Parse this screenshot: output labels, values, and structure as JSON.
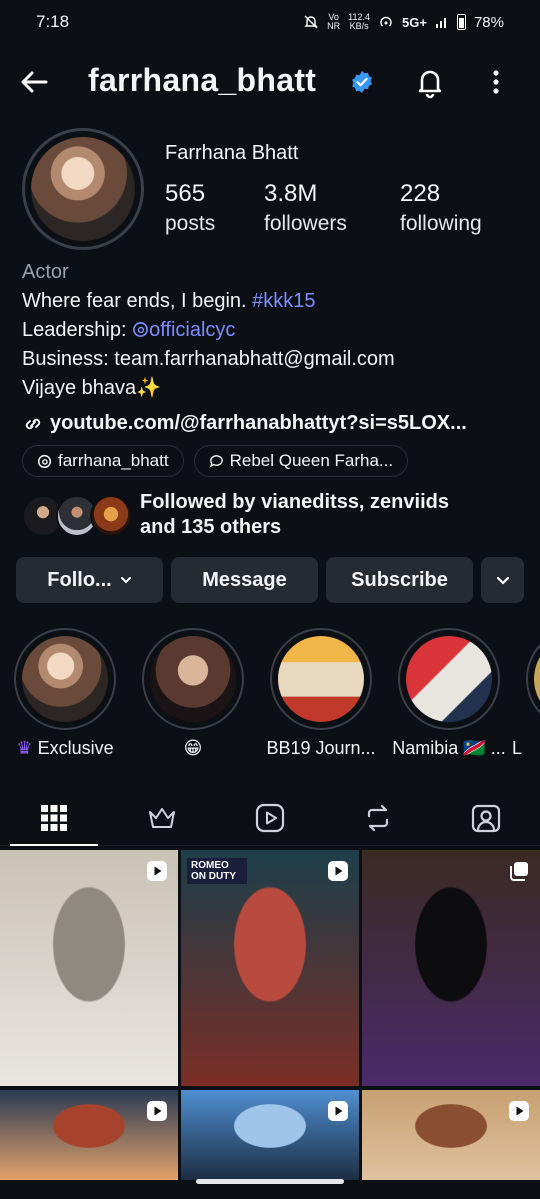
{
  "status": {
    "time": "7:18",
    "data_speed": "112.4",
    "data_unit": "KB/s",
    "volte": "Vo",
    "volte_sub": "NR",
    "network": "5G+",
    "battery": "78%",
    "battery_level": 0.78
  },
  "header": {
    "username": "farrhana_bhatt",
    "verified": true
  },
  "profile": {
    "full_name": "Farrhana Bhatt",
    "stats": [
      {
        "value": "565",
        "label": "posts"
      },
      {
        "value": "3.8M",
        "label": "followers"
      },
      {
        "value": "228",
        "label": "following"
      }
    ]
  },
  "bio": {
    "category": "Actor",
    "line1_text": "Where fear ends, I begin. ",
    "line1_tag": "#kkk15",
    "line2_text": "Leadership: ",
    "line2_handle": "officialcyc",
    "line3": "Business: team.farrhanabhatt@gmail.com",
    "line4": "Vijaye bhava✨",
    "link": "youtube.com/@farrhanabhattyt?si=s5LOX..."
  },
  "chips": [
    {
      "label": "farrhana_bhatt",
      "icon": "threads-icon"
    },
    {
      "label": "Rebel Queen Farha...",
      "icon": "chat-icon"
    }
  ],
  "followed_by": {
    "line1": "Followed by vianeditss, zenviids",
    "line2": "and 135 others"
  },
  "actions": {
    "follow": "Follo...",
    "message": "Message",
    "subscribe": "Subscribe"
  },
  "highlights": [
    {
      "label": "Exclusive",
      "prefix_icon": "crown-icon"
    },
    {
      "label": "😁"
    },
    {
      "label": "BB19 Journ..."
    },
    {
      "label": "Namibia 🇳🇦 ..."
    },
    {
      "label": "L"
    }
  ],
  "tabs": [
    "grid-icon",
    "crown-icon",
    "reels-icon",
    "repost-icon",
    "tagged-icon"
  ],
  "grid_posts": [
    {
      "type": "reel",
      "colors": [
        "#c9c3b6",
        "#8f8a80",
        "#e9e6e0"
      ]
    },
    {
      "type": "reel",
      "colors": [
        "#1c3e4a",
        "#b94b3e",
        "#7a2e26"
      ],
      "overlay": "ROMEO ON DUTY"
    },
    {
      "type": "carousel",
      "colors": [
        "#3a2a22",
        "#0d0d10",
        "#4b2a6a"
      ]
    },
    {
      "type": "reel",
      "colors": [
        "#2b3a55",
        "#a7432c",
        "#e2a26a"
      ]
    },
    {
      "type": "reel",
      "colors": [
        "#4f8fd1",
        "#9fc6ea",
        "#1c2d42"
      ]
    },
    {
      "type": "reel",
      "colors": [
        "#c7a070",
        "#8a4e32",
        "#e0c2a0"
      ]
    }
  ]
}
